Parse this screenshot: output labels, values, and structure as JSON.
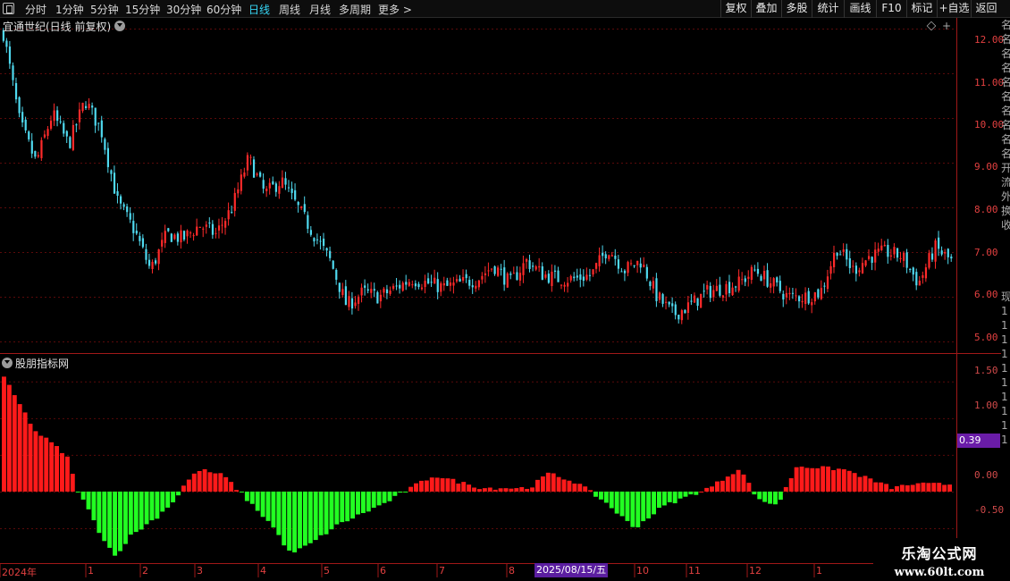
{
  "toolbar": {
    "periods": [
      "分时",
      "1分钟",
      "5分钟",
      "15分钟",
      "30分钟",
      "60分钟",
      "日线",
      "周线",
      "月线",
      "多周期",
      "更多 >"
    ],
    "active_period": "日线",
    "right_buttons": [
      "复权",
      "叠加",
      "多股",
      "统计",
      "画线",
      "F10",
      "标记",
      "+自选",
      "返回"
    ]
  },
  "price_panel": {
    "title": "宜通世纪(日线 前复权)",
    "axis_labels": [
      "12.00",
      "11.00",
      "10.00",
      "9.00",
      "8.00",
      "7.00",
      "6.00",
      "5.00"
    ]
  },
  "indicator_panel": {
    "title": "股朋指标网",
    "axis_labels": [
      "1.50",
      "1.00",
      "0.50",
      "0.00",
      "-0.50"
    ],
    "current_value": "0.39"
  },
  "right_column": [
    "名",
    "名",
    "名",
    "名",
    "名",
    "名",
    "名",
    "名",
    "名",
    "名",
    "开",
    "流",
    "外",
    "换",
    "收",
    "",
    "",
    "",
    "",
    "现",
    "1",
    "1",
    "1",
    "1",
    "1",
    "1",
    "1",
    "1",
    "1",
    "1"
  ],
  "date_axis": {
    "labels": [
      "2024年",
      "1",
      "2",
      "3",
      "4",
      "5",
      "6",
      "7",
      "8",
      "10",
      "11",
      "12",
      "1"
    ],
    "cursor_date": "2025/08/15/五"
  },
  "watermark": {
    "line1": "乐淘公式网",
    "line2": "www.60lt.com"
  },
  "colors": {
    "up": "#ff2a2a",
    "down": "#4fd9ef",
    "positive_bar": "#ff1a1a",
    "negative_bar": "#22ff22",
    "grid": "#5a0a0a",
    "panel_border": "#a01818"
  },
  "chart_data": [
    {
      "type": "candlestick",
      "title": "宜通世纪(日线 前复权)",
      "ylim": [
        4.8,
        12.2
      ],
      "y_ticks": [
        5,
        6,
        7,
        8,
        9,
        10,
        11,
        12
      ],
      "x_start": "2024",
      "x_end": "2026-01",
      "month_ticks": [
        "2024年",
        "1",
        "2",
        "3",
        "4",
        "5",
        "6",
        "7",
        "8",
        "10",
        "11",
        "12",
        "1"
      ],
      "close_path": [
        [
          "2024-12",
          11.9
        ],
        [
          "2024-12",
          9.9
        ],
        [
          "2024-12",
          9.0
        ],
        [
          "2024-12",
          10.1
        ],
        [
          "2024-12",
          9.4
        ],
        [
          "2025-01",
          10.4
        ],
        [
          "2025-01",
          9.7
        ],
        [
          "2025-01",
          8.1
        ],
        [
          "2025-01",
          7.5
        ],
        [
          "2025-01",
          6.6
        ],
        [
          "2025-02",
          7.4
        ],
        [
          "2025-02",
          7.3
        ],
        [
          "2025-02",
          7.6
        ],
        [
          "2025-02",
          7.4
        ],
        [
          "2025-02",
          8.0
        ],
        [
          "2025-03",
          9.1
        ],
        [
          "2025-03",
          8.3
        ],
        [
          "2025-03",
          8.6
        ],
        [
          "2025-03",
          8.0
        ],
        [
          "2025-03",
          7.4
        ],
        [
          "2025-04",
          6.8
        ],
        [
          "2025-04",
          5.8
        ],
        [
          "2025-04",
          6.1
        ],
        [
          "2025-04",
          6.0
        ],
        [
          "2025-04",
          6.2
        ],
        [
          "2025-05",
          6.4
        ],
        [
          "2025-05",
          6.3
        ],
        [
          "2025-05",
          6.2
        ],
        [
          "2025-05",
          6.3
        ],
        [
          "2025-05",
          6.4
        ],
        [
          "2025-06",
          6.7
        ],
        [
          "2025-06",
          6.3
        ],
        [
          "2025-06",
          6.8
        ],
        [
          "2025-07",
          6.5
        ],
        [
          "2025-07",
          6.4
        ],
        [
          "2025-08",
          6.4
        ],
        [
          "2025-08",
          6.5
        ],
        [
          "2025-08",
          7.1
        ],
        [
          "2025-08",
          6.6
        ],
        [
          "2025-08",
          6.8
        ],
        [
          "2025-10",
          6.0
        ],
        [
          "2025-10",
          5.6
        ],
        [
          "2025-10",
          5.8
        ],
        [
          "2025-10",
          6.1
        ],
        [
          "2025-11",
          6.2
        ],
        [
          "2025-11",
          6.3
        ],
        [
          "2025-11",
          6.6
        ],
        [
          "2025-11",
          6.3
        ],
        [
          "2025-12",
          6.0
        ],
        [
          "2025-12",
          6.0
        ],
        [
          "2025-12",
          6.1
        ],
        [
          "2025-12",
          7.1
        ],
        [
          "2025-12",
          6.6
        ],
        [
          "2025-12",
          6.9
        ],
        [
          "2026-01",
          7.0
        ],
        [
          "2026-01",
          6.9
        ],
        [
          "2026-01",
          6.3
        ],
        [
          "2026-01",
          7.1
        ],
        [
          "2026-01",
          6.8
        ]
      ]
    },
    {
      "type": "bar",
      "title": "股朋指标网",
      "ylim": [
        -0.95,
        1.85
      ],
      "y_ticks": [
        1.5,
        1.0,
        0.5,
        0.0,
        -0.5
      ],
      "current_value": 0.39,
      "profile": [
        [
          0.0,
          1.55
        ],
        [
          0.016,
          1.2
        ],
        [
          0.033,
          0.82
        ],
        [
          0.05,
          0.66
        ],
        [
          0.066,
          0.48
        ],
        [
          0.076,
          0.05
        ],
        [
          0.083,
          -0.12
        ],
        [
          0.1,
          -0.55
        ],
        [
          0.116,
          -0.88
        ],
        [
          0.133,
          -0.6
        ],
        [
          0.16,
          -0.35
        ],
        [
          0.18,
          -0.1
        ],
        [
          0.19,
          0.12
        ],
        [
          0.205,
          0.3
        ],
        [
          0.23,
          0.22
        ],
        [
          0.25,
          -0.05
        ],
        [
          0.28,
          -0.45
        ],
        [
          0.3,
          -0.85
        ],
        [
          0.32,
          -0.72
        ],
        [
          0.35,
          -0.45
        ],
        [
          0.4,
          -0.15
        ],
        [
          0.43,
          0.08
        ],
        [
          0.45,
          0.22
        ],
        [
          0.5,
          0.05
        ],
        [
          0.55,
          0.05
        ],
        [
          0.57,
          0.25
        ],
        [
          0.6,
          0.12
        ],
        [
          0.63,
          -0.15
        ],
        [
          0.66,
          -0.5
        ],
        [
          0.69,
          -0.2
        ],
        [
          0.74,
          0.06
        ],
        [
          0.77,
          0.32
        ],
        [
          0.79,
          -0.12
        ],
        [
          0.81,
          -0.18
        ],
        [
          0.83,
          0.35
        ],
        [
          0.88,
          0.3
        ],
        [
          0.93,
          0.05
        ],
        [
          0.95,
          0.1
        ]
      ]
    }
  ]
}
